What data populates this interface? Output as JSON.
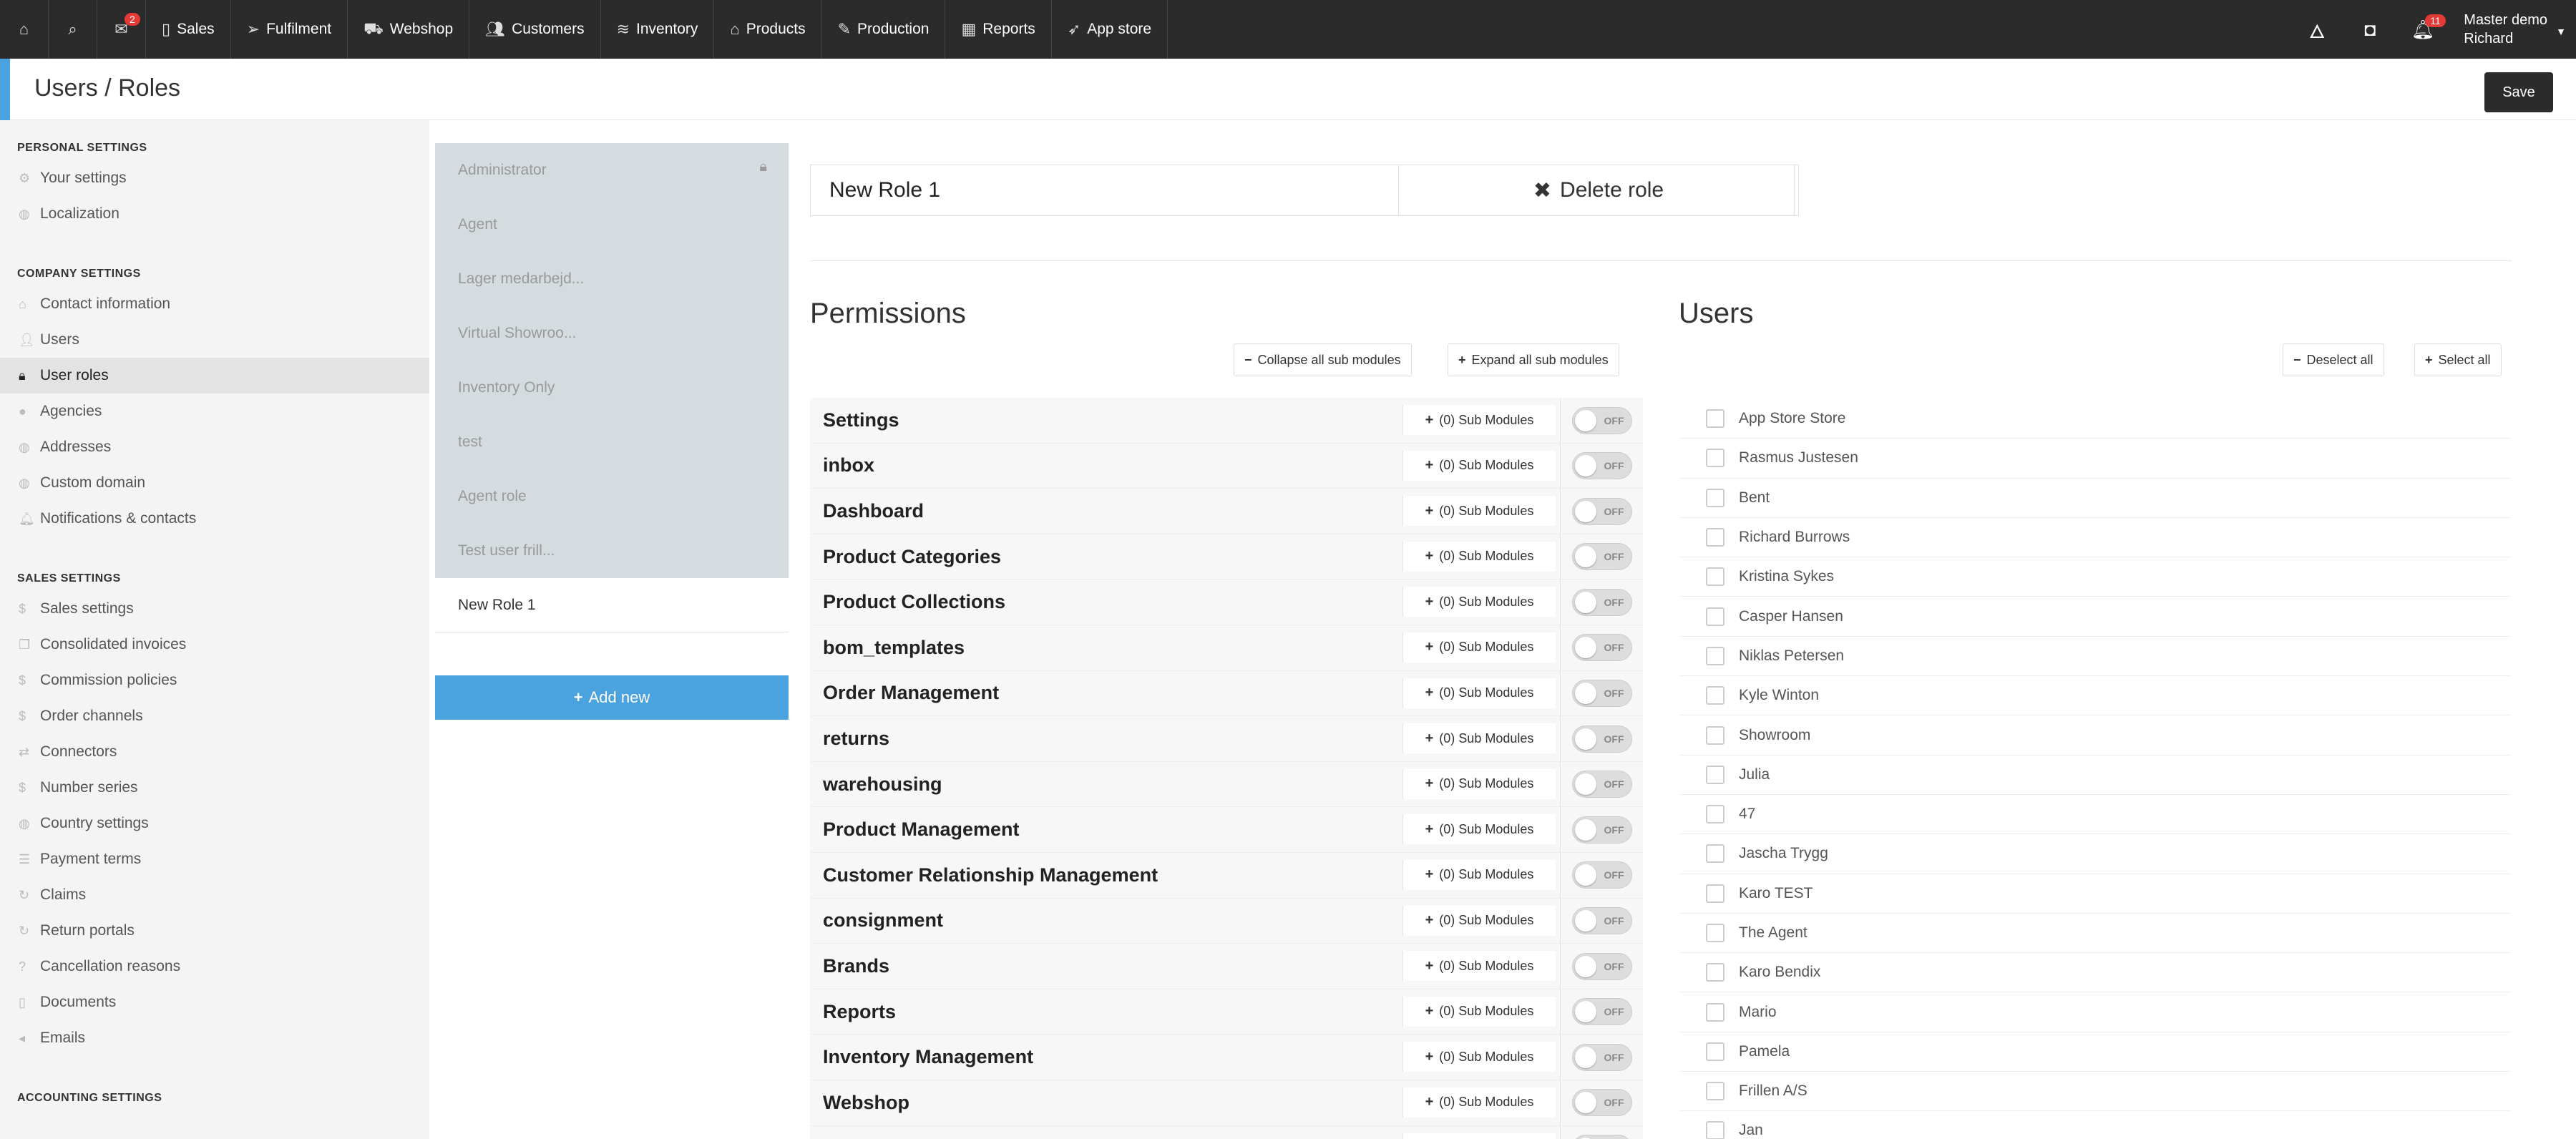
{
  "topbar": {
    "inbox_badge": "2",
    "nav": [
      {
        "label": "Sales",
        "icon": "document-icon"
      },
      {
        "label": "Fulfilment",
        "icon": "paper-plane-icon"
      },
      {
        "label": "Webshop",
        "icon": "cart-icon"
      },
      {
        "label": "Customers",
        "icon": "users-icon"
      },
      {
        "label": "Inventory",
        "icon": "layers-icon"
      },
      {
        "label": "Products",
        "icon": "tag-icon"
      },
      {
        "label": "Production",
        "icon": "pencil-icon"
      },
      {
        "label": "Reports",
        "icon": "calculator-icon"
      },
      {
        "label": "App store",
        "icon": "rocket-icon"
      }
    ],
    "notif_badge": "11",
    "user_line1": "Master demo",
    "user_line2": "Richard"
  },
  "header": {
    "title": "Users / Roles",
    "save_label": "Save"
  },
  "sidebar": {
    "sections": [
      {
        "title": "PERSONAL SETTINGS",
        "items": [
          {
            "label": "Your settings",
            "icon": "gear-icon"
          },
          {
            "label": "Localization",
            "icon": "globe-icon"
          }
        ]
      },
      {
        "title": "COMPANY SETTINGS",
        "items": [
          {
            "label": "Contact information",
            "icon": "home-icon"
          },
          {
            "label": "Users",
            "icon": "user-icon"
          },
          {
            "label": "User roles",
            "icon": "lock-icon",
            "active": true
          },
          {
            "label": "Agencies",
            "icon": "circle-icon"
          },
          {
            "label": "Addresses",
            "icon": "globe-icon"
          },
          {
            "label": "Custom domain",
            "icon": "globe-icon"
          },
          {
            "label": "Notifications & contacts",
            "icon": "bell-icon"
          }
        ]
      },
      {
        "title": "SALES SETTINGS",
        "items": [
          {
            "label": "Sales settings",
            "icon": "dollar-icon"
          },
          {
            "label": "Consolidated invoices",
            "icon": "copy-icon"
          },
          {
            "label": "Commission policies",
            "icon": "dollar-icon"
          },
          {
            "label": "Order channels",
            "icon": "dollar-icon"
          },
          {
            "label": "Connectors",
            "icon": "exchange-icon"
          },
          {
            "label": "Number series",
            "icon": "dollar-icon"
          },
          {
            "label": "Country settings",
            "icon": "globe-icon"
          },
          {
            "label": "Payment terms",
            "icon": "list-icon"
          },
          {
            "label": "Claims",
            "icon": "refresh-icon"
          },
          {
            "label": "Return portals",
            "icon": "refresh-icon"
          },
          {
            "label": "Cancellation reasons",
            "icon": "question-icon"
          },
          {
            "label": "Documents",
            "icon": "document-icon"
          },
          {
            "label": "Emails",
            "icon": "send-icon"
          }
        ]
      },
      {
        "title": "ACCOUNTING SETTINGS",
        "items": []
      }
    ]
  },
  "roles": {
    "items": [
      {
        "label": "Administrator",
        "locked": true
      },
      {
        "label": "Agent"
      },
      {
        "label": "Lager medarbejd..."
      },
      {
        "label": "Virtual Showroo..."
      },
      {
        "label": "Inventory Only"
      },
      {
        "label": "test"
      },
      {
        "label": "Agent role"
      },
      {
        "label": "Test user frill..."
      },
      {
        "label": "New Role 1",
        "active": true
      }
    ],
    "add_new_label": "Add new"
  },
  "editor": {
    "role_name": "New Role 1",
    "delete_label": "Delete role"
  },
  "permissions": {
    "title": "Permissions",
    "collapse_label": "Collapse all sub modules",
    "expand_label": "Expand all sub modules",
    "sub_modules_label": "(0) Sub Modules",
    "toggle_label": "OFF",
    "items": [
      "Settings",
      "inbox",
      "Dashboard",
      "Product Categories",
      "Product Collections",
      "bom_templates",
      "Order Management",
      "returns",
      "warehousing",
      "Product Management",
      "Customer Relationship Management",
      "consignment",
      "Brands",
      "Reports",
      "Inventory Management",
      "Webshop",
      ""
    ]
  },
  "users": {
    "title": "Users",
    "deselect_label": "Deselect all",
    "select_label": "Select all",
    "items": [
      "App Store Store",
      "Rasmus Justesen",
      "Bent",
      "Richard Burrows",
      "Kristina Sykes",
      "Casper Hansen",
      "Niklas Petersen",
      "Kyle Winton",
      "Showroom",
      "Julia",
      "47",
      "Jascha Trygg",
      "Karo TEST",
      "The Agent",
      "Karo Bendix",
      "Mario",
      "Pamela",
      "Frillen A/S",
      "Jan"
    ]
  }
}
